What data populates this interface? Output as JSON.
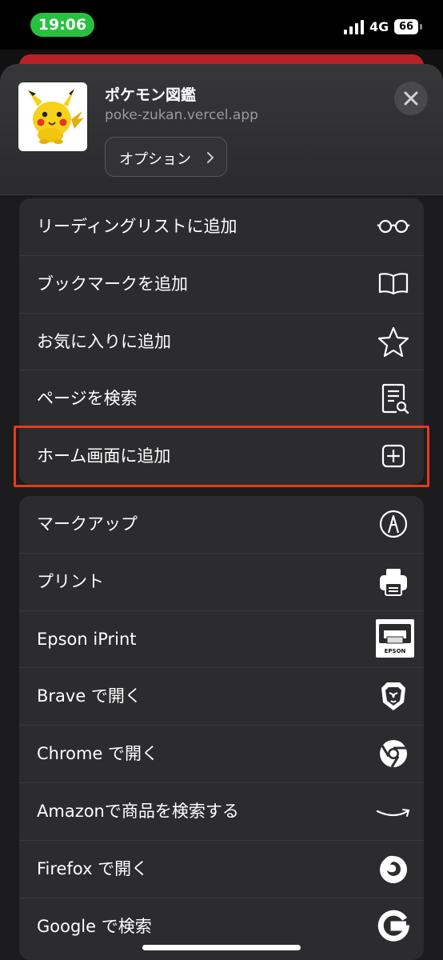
{
  "status_bar": {
    "time": "19:06",
    "network": "4G",
    "battery": "66"
  },
  "app": {
    "title": "ポケモン図鑑",
    "url": "poke-zukan.vercel.app",
    "options_label": "オプション"
  },
  "group1": [
    {
      "label": "リーディングリストに追加",
      "icon": "glasses-icon"
    },
    {
      "label": "ブックマークを追加",
      "icon": "book-icon"
    },
    {
      "label": "お気に入りに追加",
      "icon": "star-icon"
    },
    {
      "label": "ページを検索",
      "icon": "doc-search-icon"
    },
    {
      "label": "ホーム画面に追加",
      "icon": "plus-square-icon"
    }
  ],
  "group2": [
    {
      "label": "マークアップ",
      "icon": "markup-icon"
    },
    {
      "label": "プリント",
      "icon": "printer-icon"
    },
    {
      "label": "Epson iPrint",
      "icon": "epson-icon",
      "icon_text": "EPSON"
    },
    {
      "label": "Brave で開く",
      "icon": "brave-icon"
    },
    {
      "label": "Chrome で開く",
      "icon": "chrome-icon"
    },
    {
      "label": "Amazonで商品を検索する",
      "icon": "amazon-icon"
    },
    {
      "label": "Firefox で開く",
      "icon": "firefox-icon"
    },
    {
      "label": "Google で検索",
      "icon": "google-icon"
    }
  ],
  "colors": {
    "highlight": "#e83a1d",
    "time_pill": "#27c13f",
    "sheet": "#1c1c1e",
    "row": "#2c2c2e"
  }
}
